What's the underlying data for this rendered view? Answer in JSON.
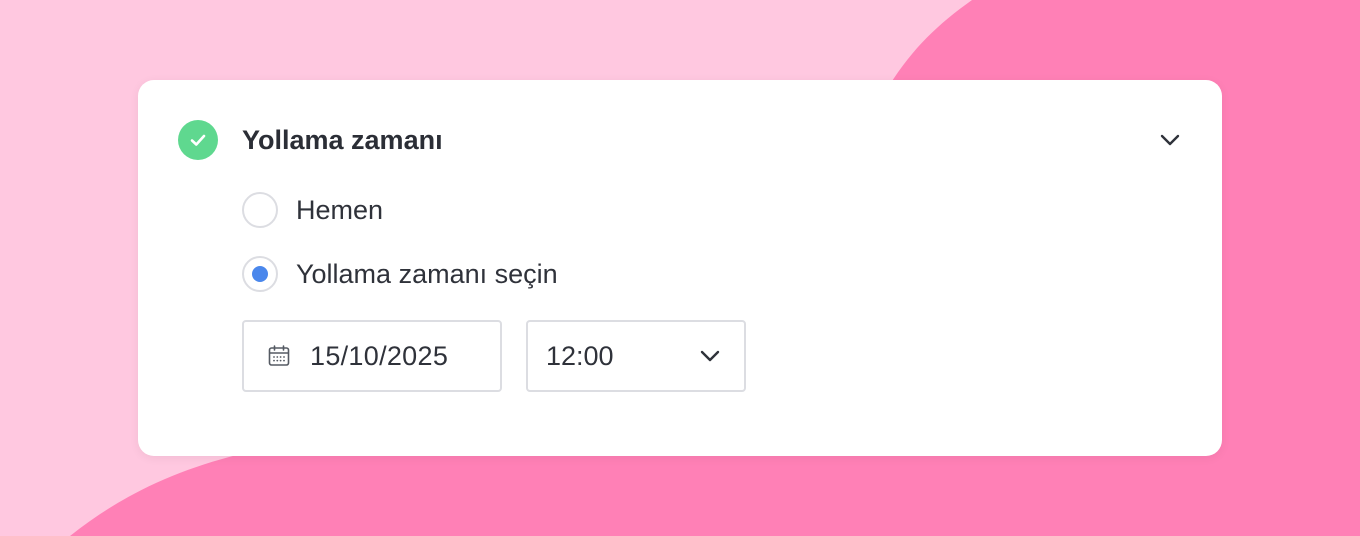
{
  "section": {
    "title": "Yollama zamanı",
    "status_icon": "check-circle-icon",
    "collapse_icon": "chevron-down-icon"
  },
  "options": [
    {
      "label": "Hemen",
      "selected": false
    },
    {
      "label": "Yollama zamanı seçin",
      "selected": true
    }
  ],
  "date_field": {
    "icon": "calendar-icon",
    "value": "15/10/2025"
  },
  "time_select": {
    "value": "12:00",
    "icon": "chevron-down-icon"
  },
  "colors": {
    "background_light": "#ffc8e0",
    "background_dark": "#ff80b6",
    "success": "#5fd88f",
    "accent": "#4a87ec",
    "text": "#2f323a"
  }
}
